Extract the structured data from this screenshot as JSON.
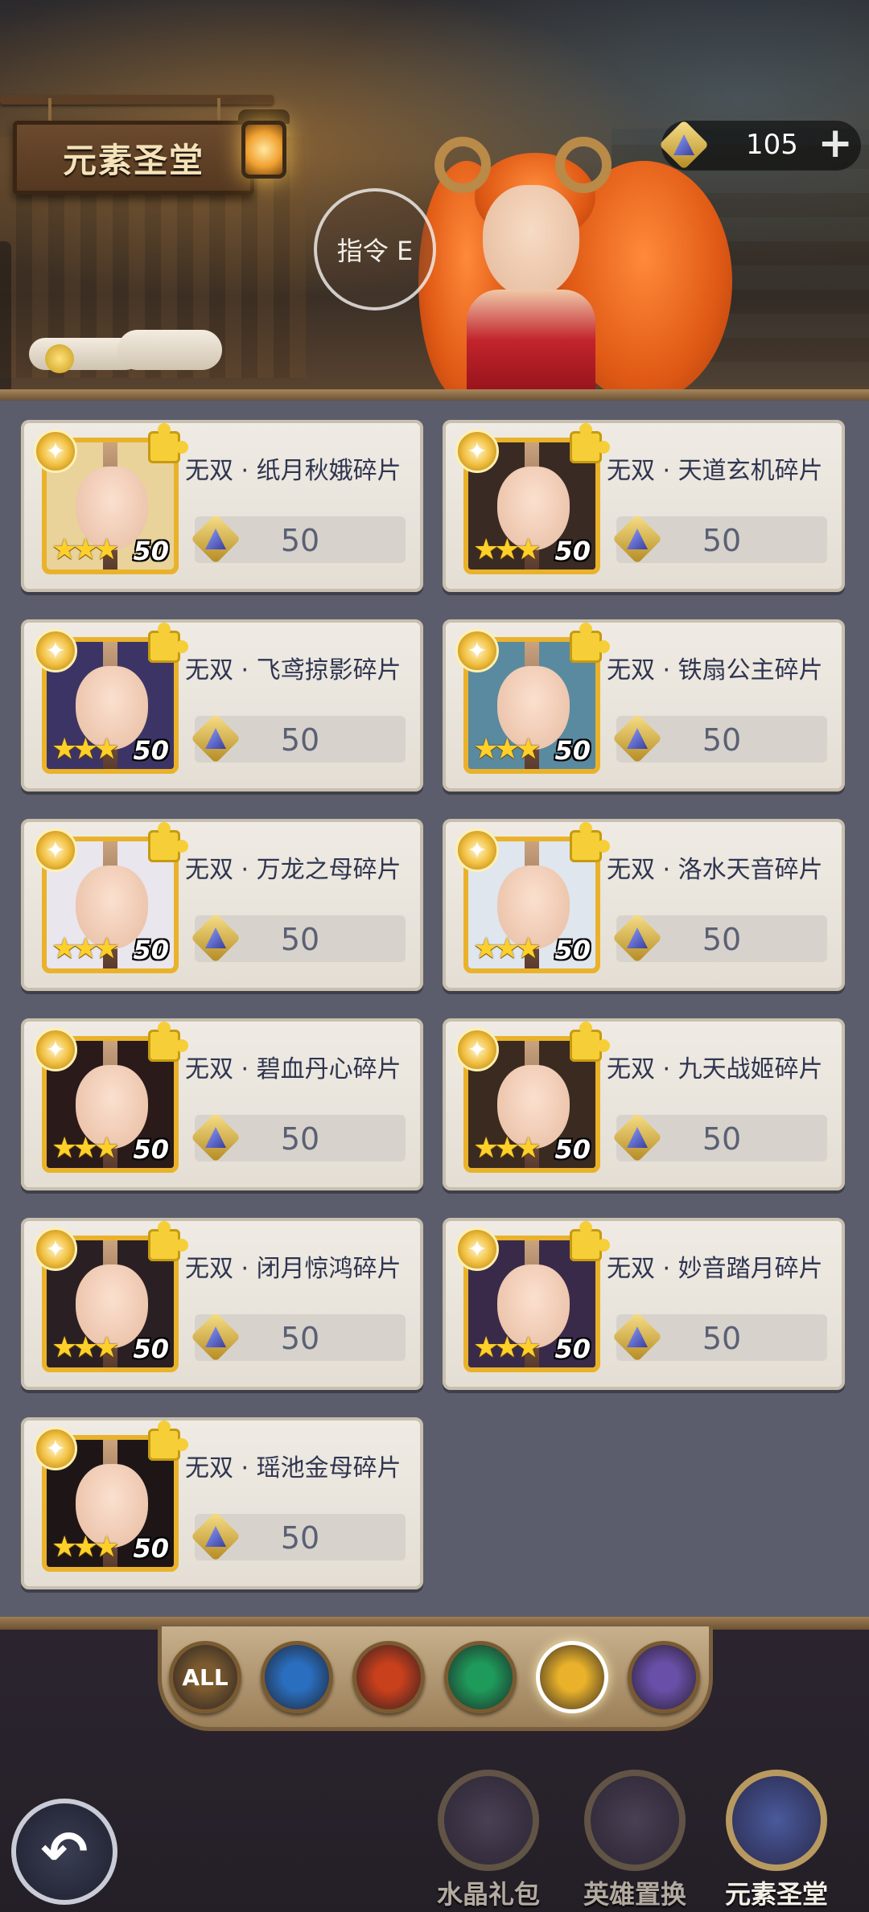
{
  "header": {
    "title": "元素圣堂",
    "command_label": "指令 E",
    "currency_value": "105",
    "currency_plus": "+"
  },
  "items": [
    {
      "name": "无双 · 纸月秋娥碎片",
      "stars": "★★★",
      "level": "50",
      "price": "50",
      "hair": "#e9d39a"
    },
    {
      "name": "无双 · 天道玄机碎片",
      "stars": "★★★",
      "level": "50",
      "price": "50",
      "hair": "#3a2a24"
    },
    {
      "name": "无双 · 飞鸢掠影碎片",
      "stars": "★★★",
      "level": "50",
      "price": "50",
      "hair": "#3d3466"
    },
    {
      "name": "无双 · 铁扇公主碎片",
      "stars": "★★★",
      "level": "50",
      "price": "50",
      "hair": "#5a8aa0"
    },
    {
      "name": "无双 · 万龙之母碎片",
      "stars": "★★★",
      "level": "50",
      "price": "50",
      "hair": "#eae6ee"
    },
    {
      "name": "无双 · 洛水天音碎片",
      "stars": "★★★",
      "level": "50",
      "price": "50",
      "hair": "#dfe6ee"
    },
    {
      "name": "无双 · 碧血丹心碎片",
      "stars": "★★★",
      "level": "50",
      "price": "50",
      "hair": "#2a1a1a"
    },
    {
      "name": "无双 · 九天战姬碎片",
      "stars": "★★★",
      "level": "50",
      "price": "50",
      "hair": "#3a2a20"
    },
    {
      "name": "无双 · 闭月惊鸿碎片",
      "stars": "★★★",
      "level": "50",
      "price": "50",
      "hair": "#2a2024"
    },
    {
      "name": "无双 · 妙音踏月碎片",
      "stars": "★★★",
      "level": "50",
      "price": "50",
      "hair": "#3a2a4a"
    },
    {
      "name": "无双 · 瑶池金母碎片",
      "stars": "★★★",
      "level": "50",
      "price": "50",
      "hair": "#1e1616"
    }
  ],
  "filters": [
    {
      "label": "ALL",
      "icon": "all-icon",
      "color": "#7a5a2e",
      "active": false
    },
    {
      "label": "",
      "icon": "water-element-icon",
      "color": "#2a6fbf",
      "active": false
    },
    {
      "label": "",
      "icon": "fire-element-icon",
      "color": "#c8401c",
      "active": false
    },
    {
      "label": "",
      "icon": "wind-element-icon",
      "color": "#1e9a5a",
      "active": false
    },
    {
      "label": "",
      "icon": "light-element-icon",
      "color": "#e9b22a",
      "active": true
    },
    {
      "label": "",
      "icon": "dark-element-icon",
      "color": "#6a4fa8",
      "active": false
    }
  ],
  "nav": {
    "back_label": "↶",
    "items": [
      {
        "label": "水晶礼包",
        "active": false
      },
      {
        "label": "英雄置换",
        "active": false
      },
      {
        "label": "元素圣堂",
        "active": true
      }
    ]
  },
  "colors": {
    "accent_gold": "#e9b22a",
    "card_bg": "#efebe4",
    "panel_bg": "#5b5d6c"
  }
}
